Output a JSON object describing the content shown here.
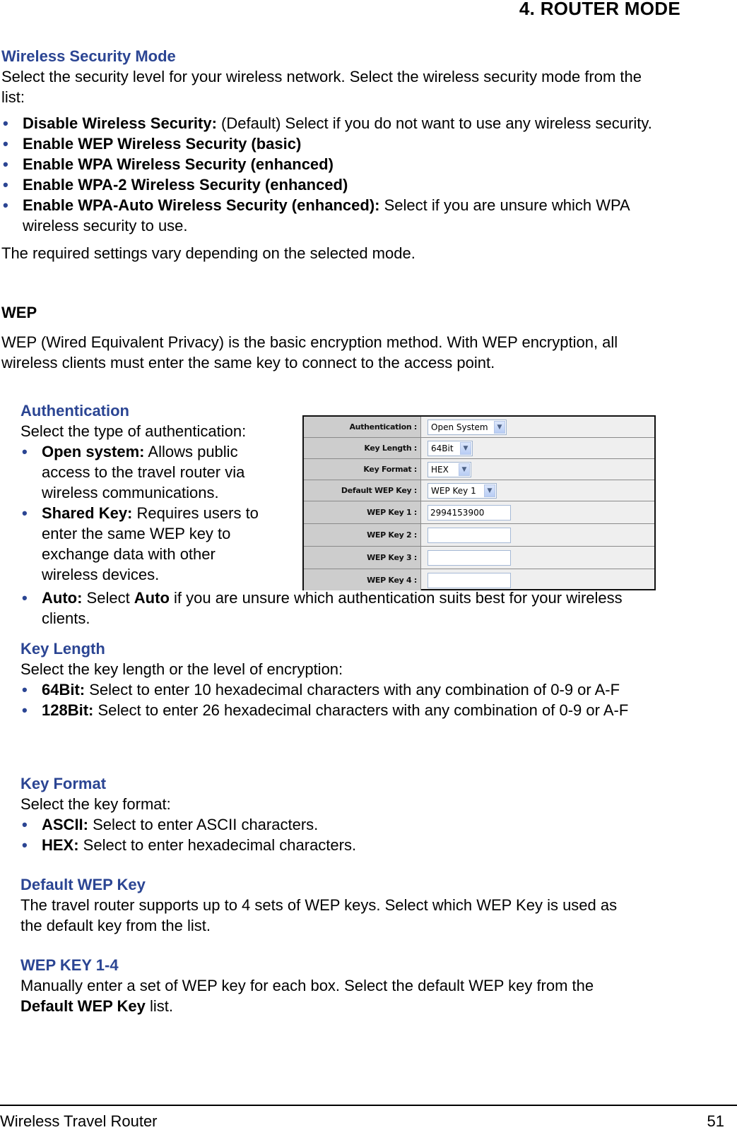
{
  "header": {
    "chapter_title": "4.  ROUTER MODE"
  },
  "security_mode": {
    "heading": "Wireless Security Mode",
    "intro": "Select the security level for your wireless network. Select the wireless security mode from the list:",
    "items": [
      {
        "bold": "Disable Wireless Security:",
        "text": " (Default) Select if you do not want to use any wireless security."
      },
      {
        "bold": "Enable WEP Wireless Security (basic)",
        "text": ""
      },
      {
        "bold": "Enable WPA Wireless Security (enhanced)",
        "text": ""
      },
      {
        "bold": "Enable WPA-2 Wireless Security (enhanced)",
        "text": ""
      },
      {
        "bold": "Enable WPA-Auto Wireless Security (enhanced):",
        "text": " Select if you are unsure which WPA wireless security to use."
      }
    ],
    "note": "The required settings vary depending on the selected mode."
  },
  "wep": {
    "heading": "WEP",
    "description": "WEP (Wired Equivalent Privacy) is the basic encryption method. With WEP encryption, all wireless clients must enter the same key to connect to the access point."
  },
  "authentication": {
    "heading": "Authentication",
    "intro": "Select the type of authentication:",
    "items": [
      {
        "bold": "Open system:",
        "text": " Allows public access to the travel router via wireless communications."
      },
      {
        "bold": "Shared Key:",
        "text": " Requires users to enter the same WEP key to exchange data with other wireless devices."
      },
      {
        "bold": "Auto:",
        "text": " Select ",
        "bold2": "Auto",
        "text2": " if you are unsure which authentication suits best for your wireless clients."
      }
    ]
  },
  "key_length": {
    "heading": "Key Length",
    "intro": "Select the key length or the level of encryption:",
    "items": [
      {
        "bold": "64Bit:",
        "text": " Select to enter 10 hexadecimal characters with any combination of 0-9 or A-F"
      },
      {
        "bold": "128Bit:",
        "text": " Select to enter 26 hexadecimal characters with any combination of 0-9 or A-F"
      }
    ]
  },
  "key_format": {
    "heading": "Key Format",
    "intro": "Select the key format:",
    "items": [
      {
        "bold": "ASCII:",
        "text": " Select to enter ASCII characters."
      },
      {
        "bold": "HEX:",
        "text": " Select to enter hexadecimal characters."
      }
    ]
  },
  "default_wep_key": {
    "heading": "Default WEP Key",
    "description": "The travel router supports up to 4 sets of WEP keys. Select which WEP Key is used as the default key from the list."
  },
  "wep_key_1_4": {
    "heading": "WEP KEY 1-4",
    "text_before": "Manually enter a set of WEP key for each box. Select the default WEP key from the ",
    "bold": "Default WEP Key",
    "text_after": " list."
  },
  "settings_panel": {
    "authentication": {
      "label": "Authentication :",
      "value": "Open System"
    },
    "key_length": {
      "label": "Key Length :",
      "value": "64Bit"
    },
    "key_format": {
      "label": "Key Format :",
      "value": "HEX"
    },
    "default_wep_key": {
      "label": "Default WEP Key :",
      "value": "WEP Key 1"
    },
    "wep_keys": [
      {
        "label": "WEP Key 1 :",
        "value": "2994153900"
      },
      {
        "label": "WEP Key 2 :",
        "value": ""
      },
      {
        "label": "WEP Key 3 :",
        "value": ""
      },
      {
        "label": "WEP Key 4 :",
        "value": ""
      }
    ],
    "dropdown_icon": "chevron-down-icon"
  },
  "footer": {
    "product": "Wireless Travel Router",
    "page_number": "51"
  },
  "colors": {
    "heading_blue": "#2b4593",
    "label_gray": "#cdcdcd",
    "panel_bg": "#efefef"
  }
}
